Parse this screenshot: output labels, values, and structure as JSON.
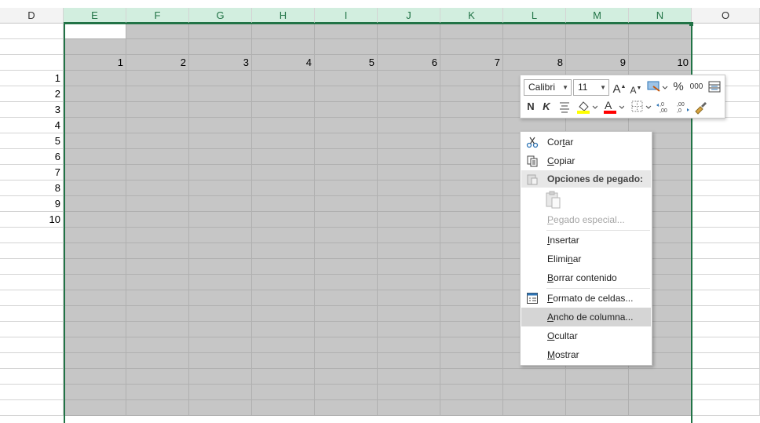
{
  "columns": [
    "D",
    "E",
    "F",
    "G",
    "H",
    "I",
    "J",
    "K",
    "L",
    "M",
    "N",
    "O"
  ],
  "selected_columns": [
    "E",
    "F",
    "G",
    "H",
    "I",
    "J",
    "K",
    "L",
    "M",
    "N"
  ],
  "header_row_numbers": [
    "1",
    "2",
    "3",
    "4",
    "5",
    "6",
    "7",
    "8",
    "9",
    "10"
  ],
  "row_labels_in_d": [
    "1",
    "2",
    "3",
    "4",
    "5",
    "6",
    "7",
    "8",
    "9",
    "10"
  ],
  "mini_toolbar": {
    "font_name": "Calibri",
    "font_size": "11",
    "bold": "N",
    "italic": "K",
    "percent": "%",
    "thousands": "000",
    "grow_font": "A",
    "shrink_font": "A",
    "font_color": "A",
    "fill_color_hex": "#ffff00",
    "font_color_hex": "#ff0000"
  },
  "context_menu": {
    "cut": {
      "pre": "Cor",
      "key": "t",
      "post": "ar"
    },
    "copy": {
      "pre": "",
      "key": "C",
      "post": "opiar"
    },
    "paste_options": "Opciones de pegado:",
    "paste_special": {
      "pre": "",
      "key": "P",
      "post": "egado especial..."
    },
    "insert": {
      "pre": "",
      "key": "I",
      "post": "nsertar"
    },
    "delete": {
      "pre": "Elimi",
      "key": "n",
      "post": "ar"
    },
    "clear": {
      "pre": "",
      "key": "B",
      "post": "orrar contenido"
    },
    "format_cells": {
      "pre": "",
      "key": "F",
      "post": "ormato de celdas..."
    },
    "column_width": {
      "pre": "",
      "key": "A",
      "post": "ncho de columna..."
    },
    "hide": {
      "pre": "",
      "key": "O",
      "post": "cultar"
    },
    "unhide": {
      "pre": "",
      "key": "M",
      "post": "ostrar"
    }
  },
  "colors": {
    "accent": "#217346",
    "selection": "#c6c6c6",
    "selected_header": "#d2eedf"
  }
}
